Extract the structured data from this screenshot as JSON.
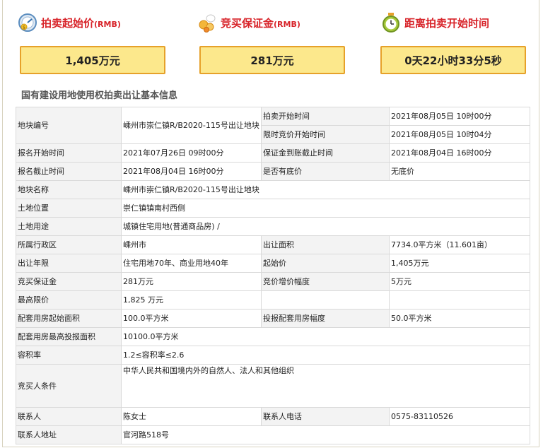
{
  "stats": [
    {
      "icon": "gauge-icon",
      "label": "拍卖起始价",
      "unit": "(RMB)",
      "value": "1,405万元"
    },
    {
      "icon": "coins-icon",
      "label": "竞买保证金",
      "unit": "(RMB)",
      "value": "281万元"
    },
    {
      "icon": "clock-icon",
      "label": "距离拍卖开始时间",
      "unit": "",
      "value": "0天22小时33分5秒"
    }
  ],
  "section_title": "国有建设用地使用权拍卖出让基本信息",
  "rows": {
    "parcel_no_label": "地块编号",
    "parcel_no": "嵊州市崇仁镇R/B2020-115号出让地块",
    "auction_start_label": "拍卖开始时间",
    "auction_start": "2021年08月05日  10时00分",
    "limit_bid_label": "限时竞价开始时间",
    "limit_bid": "2021年08月05日  10时04分",
    "reg_start_label": "报名开始时间",
    "reg_start": "2021年07月26日  09时00分",
    "deposit_deadline_label": "保证金到账截止时间",
    "deposit_deadline": "2021年08月04日  16时00分",
    "reg_end_label": "报名截止时间",
    "reg_end": "2021年08月04日  16时00分",
    "reserve_label": "是否有底价",
    "reserve": "无底价",
    "name_label": "地块名称",
    "name": "嵊州市崇仁镇R/B2020-115号出让地块",
    "location_label": "土地位置",
    "location": "崇仁镇镇南村西侧",
    "usage_label": "土地用途",
    "usage": "城镇住宅用地(普通商品房) /",
    "district_label": "所属行政区",
    "district": "嵊州市",
    "area_label": "出让面积",
    "area": "7734.0平方米（11.601亩）",
    "term_label": "出让年限",
    "term": "住宅用地70年、商业用地40年",
    "start_price_label": "起始价",
    "start_price": "1,405万元",
    "deposit_label": "竞买保证金",
    "deposit": "281万元",
    "increment_label": "竞价增价幅度",
    "increment": "5万元",
    "max_price_label": "最高限价",
    "max_price": "1,825 万元",
    "housing_start_label": "配套用房起始面积",
    "housing_start": "100.0平方米",
    "housing_step_label": "投报配套用房幅度",
    "housing_step": "50.0平方米",
    "housing_max_label": "配套用房最高投报面积",
    "housing_max": "10100.0平方米",
    "far_label": "容积率",
    "far": "1.2≤容积率≤2.6",
    "bidder_label": "竞买人条件",
    "bidder": "中华人民共和国境内外的自然人、法人和其他组织",
    "contact_label": "联系人",
    "contact": "陈女士",
    "phone_label": "联系人电话",
    "phone": "0575-83110526",
    "address_label": "联系人地址",
    "address": "官河路518号"
  }
}
